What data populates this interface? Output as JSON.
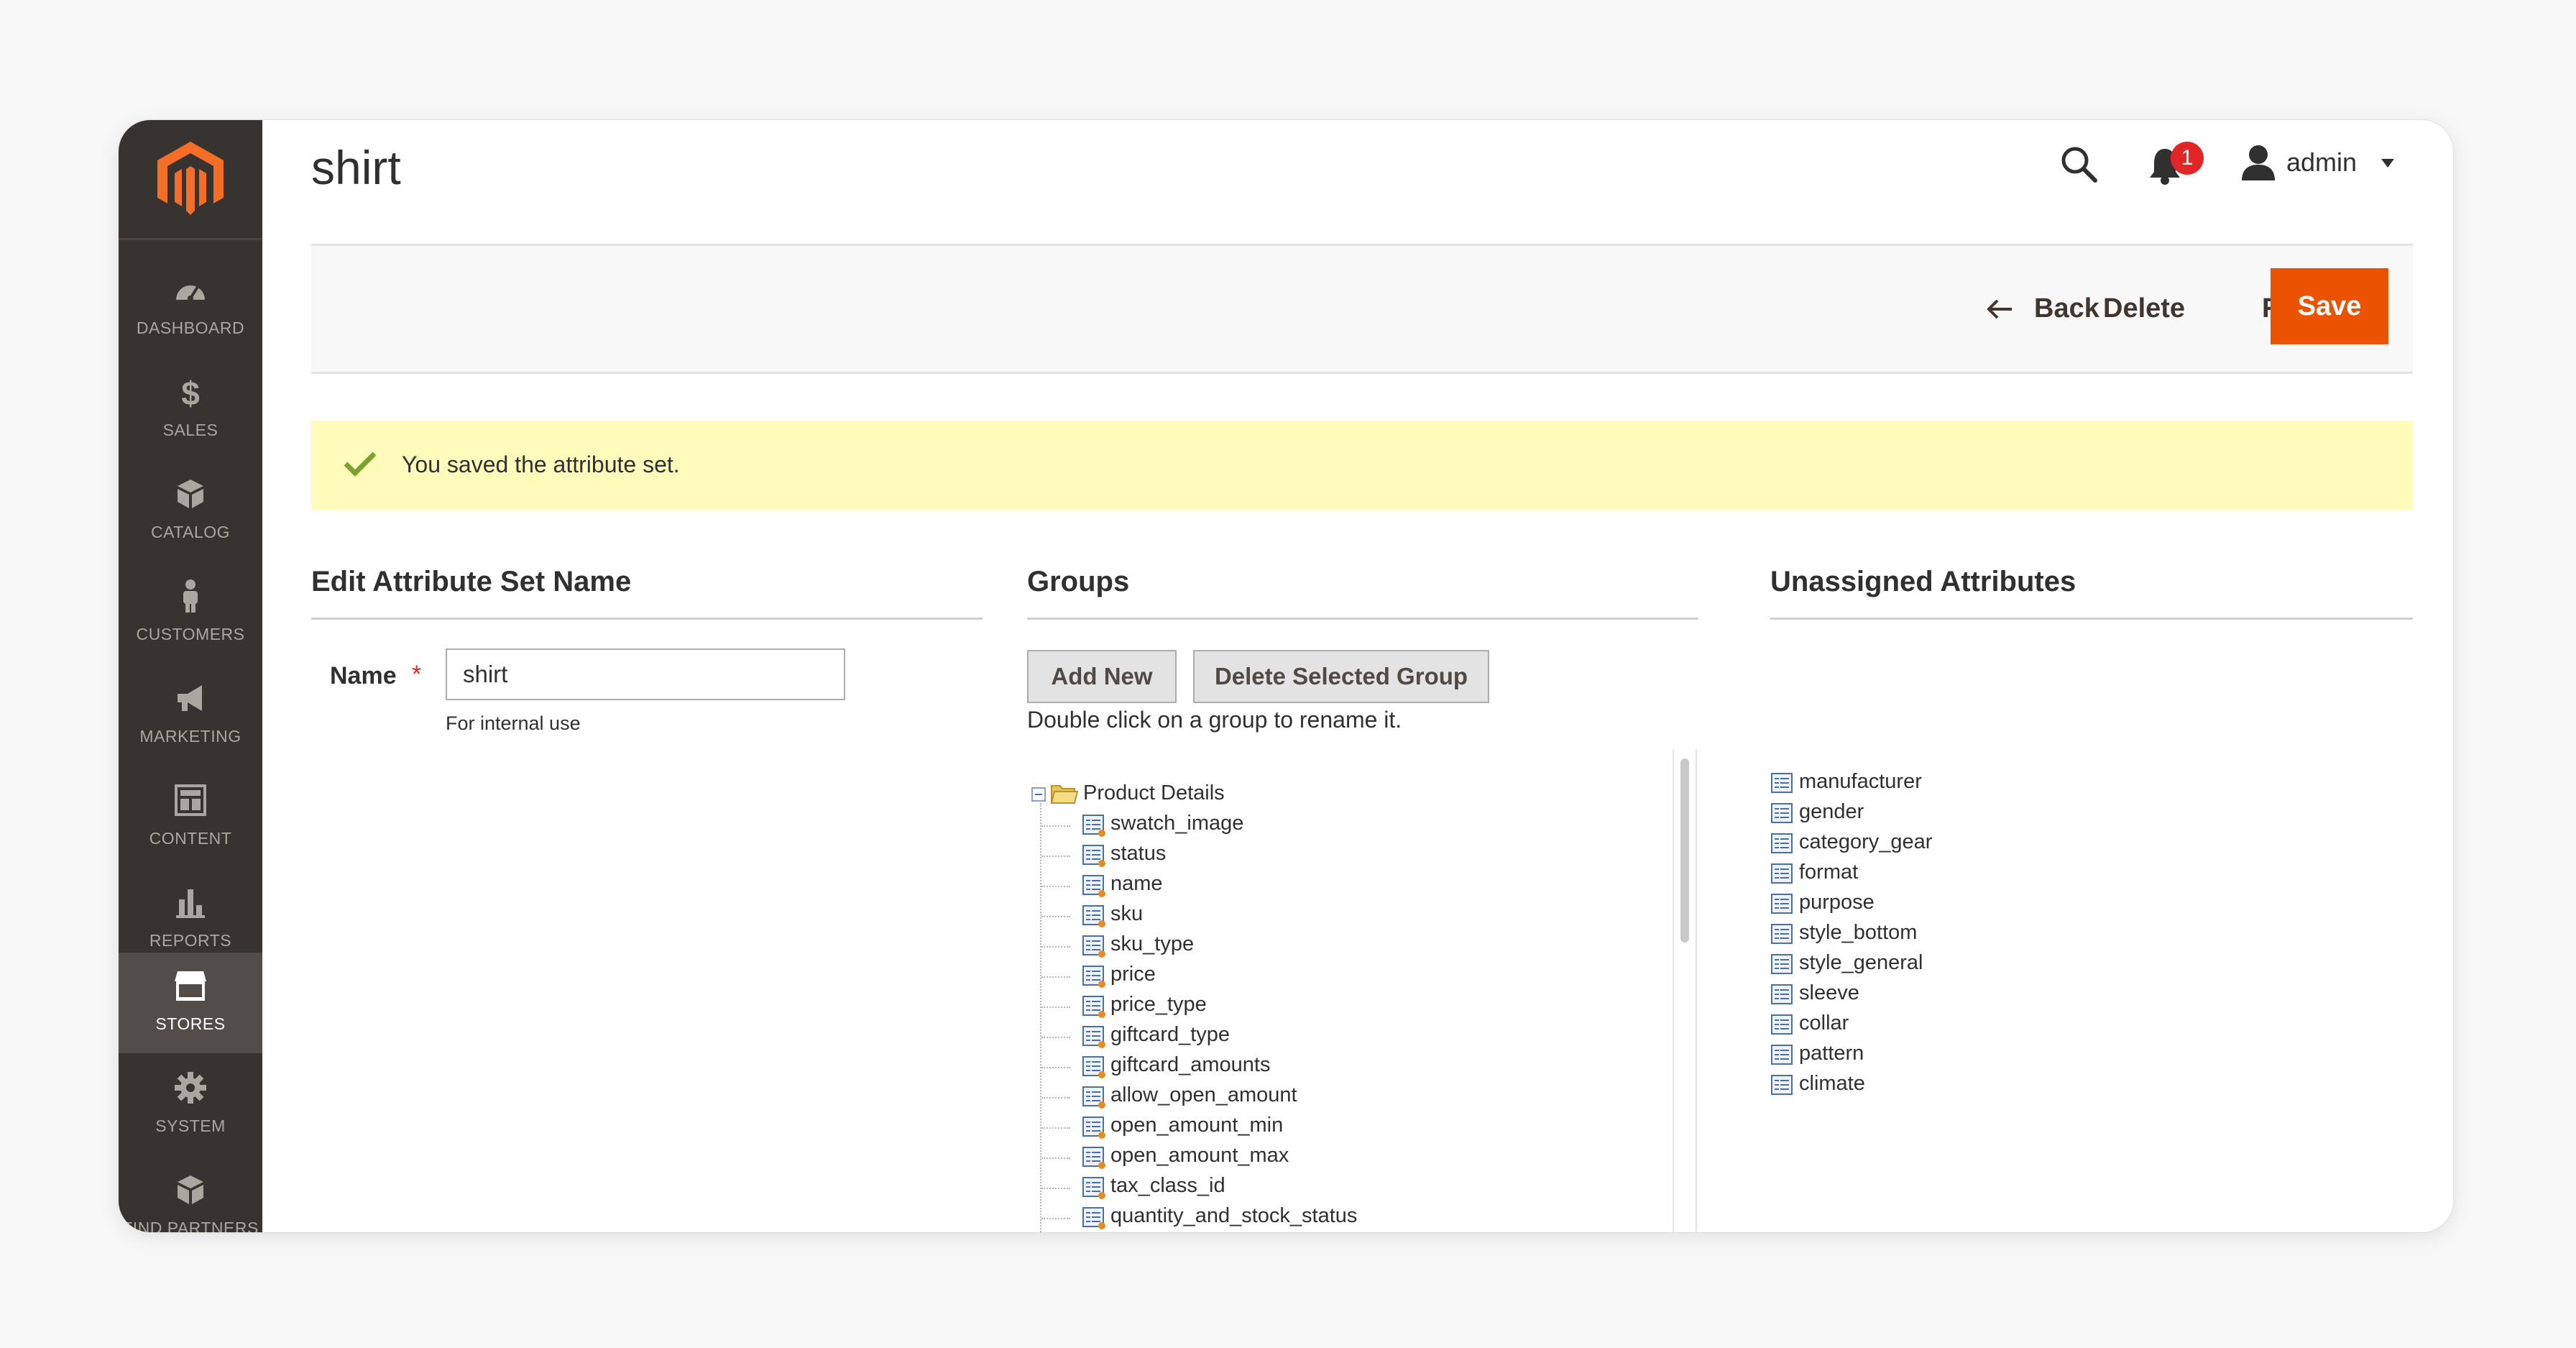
{
  "sidebar": {
    "items": [
      {
        "label": "DASHBOARD",
        "icon": "dashboard-icon"
      },
      {
        "label": "SALES",
        "icon": "dollar-icon"
      },
      {
        "label": "CATALOG",
        "icon": "cube-icon"
      },
      {
        "label": "CUSTOMERS",
        "icon": "person-icon"
      },
      {
        "label": "MARKETING",
        "icon": "megaphone-icon"
      },
      {
        "label": "CONTENT",
        "icon": "content-icon"
      },
      {
        "label": "REPORTS",
        "icon": "bar-chart-icon"
      },
      {
        "label": "STORES",
        "icon": "store-icon",
        "active": true
      },
      {
        "label": "SYSTEM",
        "icon": "gear-icon"
      },
      {
        "label": "FIND PARTNERS",
        "icon": "partners-icon"
      }
    ]
  },
  "header": {
    "title": "shirt",
    "notification_count": "1",
    "user": "admin"
  },
  "actions": {
    "back": "Back",
    "delete": "Delete",
    "reset": "Reset",
    "save": "Save"
  },
  "message": {
    "text": "You saved the attribute set."
  },
  "edit_name": {
    "title": "Edit Attribute Set Name",
    "label": "Name",
    "required_mark": "*",
    "value": "shirt",
    "note": "For internal use"
  },
  "groups": {
    "title": "Groups",
    "add_new": "Add New",
    "delete_group": "Delete Selected Group",
    "hint": "Double click on a group to rename it.",
    "root": "Product Details",
    "items": [
      "swatch_image",
      "status",
      "name",
      "sku",
      "sku_type",
      "price",
      "price_type",
      "giftcard_type",
      "giftcard_amounts",
      "allow_open_amount",
      "open_amount_min",
      "open_amount_max",
      "tax_class_id",
      "quantity_and_stock_status"
    ]
  },
  "unassigned": {
    "title": "Unassigned Attributes",
    "items": [
      "manufacturer",
      "gender",
      "category_gear",
      "format",
      "purpose",
      "style_bottom",
      "style_general",
      "sleeve",
      "collar",
      "pattern",
      "climate"
    ]
  },
  "colors": {
    "sidebar_bg": "#373330",
    "accent": "#eb5202",
    "message_bg": "#fffbbb",
    "success": "#79a22e"
  }
}
